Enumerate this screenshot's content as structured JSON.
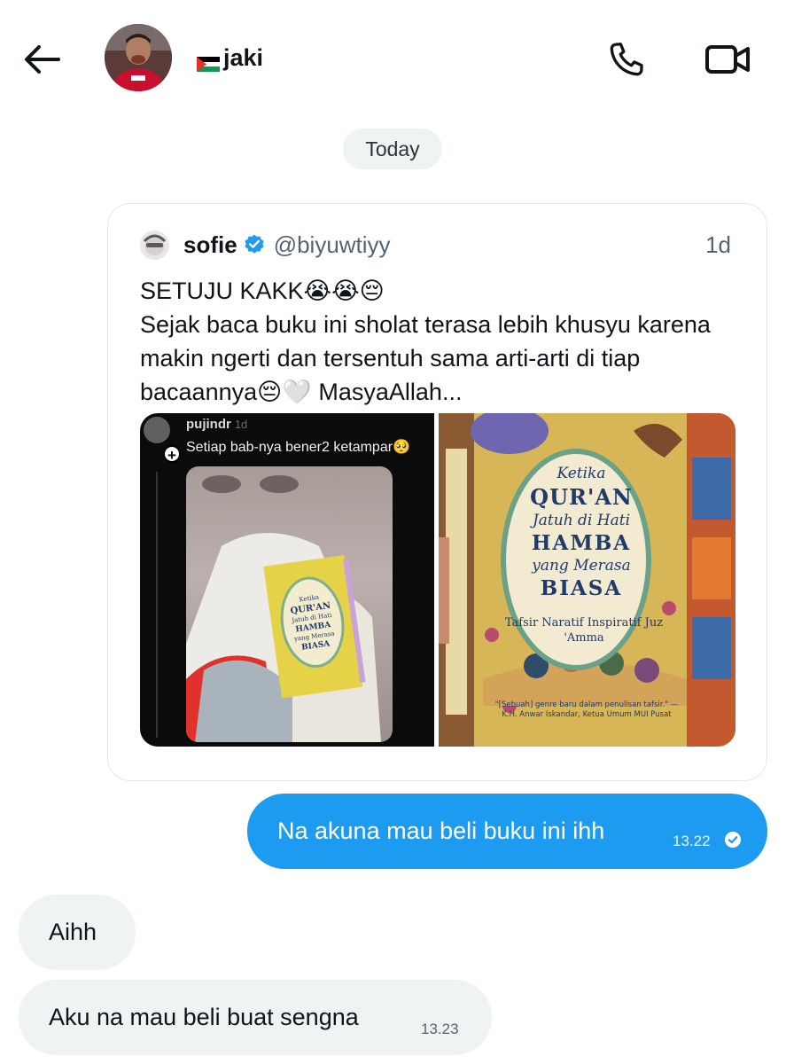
{
  "header": {
    "contact_name": "jaki",
    "flag": "palestine-flag",
    "icons": {
      "back": "arrow-left-icon",
      "call": "phone-icon",
      "video": "video-camera-icon"
    }
  },
  "divider": {
    "date_label": "Today"
  },
  "quoted_tweet": {
    "author_name": "sofie",
    "author_handle": "@biyuwtiyy",
    "verified": true,
    "time_ago": "1d",
    "text": "SETUJU KAKK😭😭😔\nSejak baca buku ini sholat terasa lebih khusyu karena makin ngerti dan tersentuh sama arti-arti di tiap bacaannya😔🤍 MasyaAllah...",
    "media": [
      {
        "kind": "screenshot",
        "username": "pujindr",
        "time": "1d",
        "caption": "Setiap bab-nya bener2 ketampar🥺"
      },
      {
        "kind": "book-cover",
        "title_lines": [
          "Ketika",
          "QUR'AN",
          "Jatuh di Hati",
          "HAMBA",
          "yang Merasa",
          "BIASA"
        ],
        "subtitle": "Tafsir Naratif Inspiratif Juz 'Amma",
        "blurb": "\"[Sebuah] genre baru dalam penulisan tafsir.\" —K.H. Anwar Iskandar, Ketua Umum MUI Pusat"
      }
    ]
  },
  "messages": {
    "outgoing": [
      {
        "text": "Na akuna mau beli buku ini ihh",
        "time": "13.22",
        "status_icon": "check-circle-icon"
      }
    ],
    "incoming": [
      {
        "text": "Aihh",
        "time": ""
      },
      {
        "text": "Aku na mau beli buat sengna",
        "time": "13.23"
      }
    ]
  },
  "colors": {
    "accent_blue": "#1d9bf0",
    "incoming_bubble": "#eff3f4",
    "text_primary": "#0f1419",
    "text_secondary": "#536471"
  }
}
